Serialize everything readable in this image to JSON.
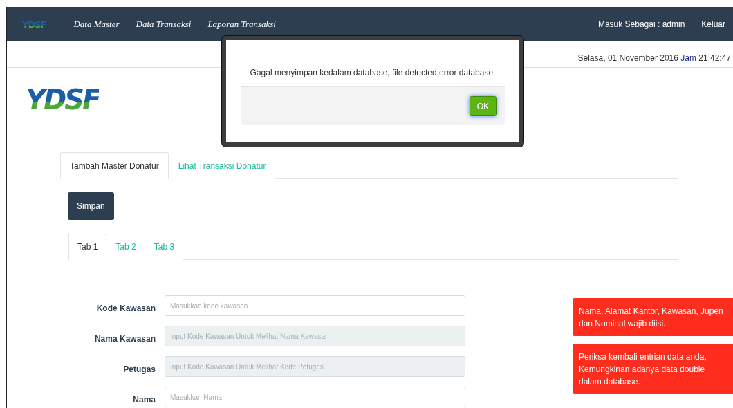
{
  "navbar": {
    "logo_text": "YDSF",
    "menu": [
      "Data Master",
      "Data Transaksi",
      "Laporan Transaksi"
    ],
    "user_label": "Masuk Sebagai : admin",
    "logout": "Keluar"
  },
  "header": {
    "date": "Selasa, 01 November 2016",
    "time_label": "Jam",
    "time": "21:42:47",
    "logo_text": "YDSF"
  },
  "main_tabs": [
    {
      "label": "Tambah Master Donatur",
      "selected": true
    },
    {
      "label": "Lihat Transaksi Donatur",
      "selected": false
    }
  ],
  "save_button": "Simpan",
  "sub_tabs": [
    {
      "label": "Tab 1",
      "selected": true
    },
    {
      "label": "Tab 2",
      "selected": false
    },
    {
      "label": "Tab 3",
      "selected": false
    }
  ],
  "form": [
    {
      "label": "Kode Kawasan",
      "placeholder": "Masukkan kode kawasan",
      "disabled": false
    },
    {
      "label": "Nama Kawasan",
      "placeholder": "Input Kode Kawasan Untuk Melihat Nama Kawasan",
      "disabled": true
    },
    {
      "label": "Petugas",
      "placeholder": "Input Kode Kawasan Untuk Melihat Kode Petugas",
      "disabled": true
    },
    {
      "label": "Nama",
      "placeholder": "Masukkan Nama",
      "disabled": false
    }
  ],
  "alerts": [
    "Nama, Alamat Kantor, Kawasan, Jupen dan Nominal wajib diisi.",
    "Periksa kembali entrian data anda, Kemungkinan adanya data double dalam database."
  ],
  "dialog": {
    "message": "Gagal menyimpan kedalam database, file detected error database.",
    "button": "OK"
  }
}
